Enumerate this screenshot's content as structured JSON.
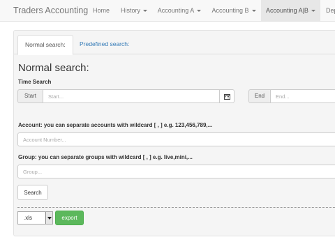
{
  "navbar": {
    "brand": "Traders Accounting",
    "items": [
      {
        "label": "Home"
      },
      {
        "label": "History"
      },
      {
        "label": "Accounting A"
      },
      {
        "label": "Accounting B"
      },
      {
        "label": "Accounting A|B"
      },
      {
        "label": "Dep"
      }
    ]
  },
  "tabs": {
    "normal": "Normal search:",
    "predefined": "Predefined search:"
  },
  "main": {
    "heading": "Normal search:",
    "time_search_label": "Time Search",
    "start_label": "Start",
    "start_placeholder": "Start...",
    "end_label": "End",
    "end_placeholder": "End...",
    "account_label": "Account: you can separate accounts with wildcard [ , ] e.g. 123,456,789,...",
    "account_placeholder": "Account Number...",
    "group_label": "Group: you can separate groups with wildcard [ , ] e.g. live,mini,...",
    "group_placeholder": "Group...",
    "search_button": "Search",
    "format_selected": ".xls",
    "export_button": "export"
  },
  "colors": {
    "navbar_bg": "#f8f8f8",
    "active_nav_bg": "#e7e7e7",
    "panel_bg": "#f5f5f5",
    "link": "#337ab7",
    "export_green": "#5cb85c"
  }
}
